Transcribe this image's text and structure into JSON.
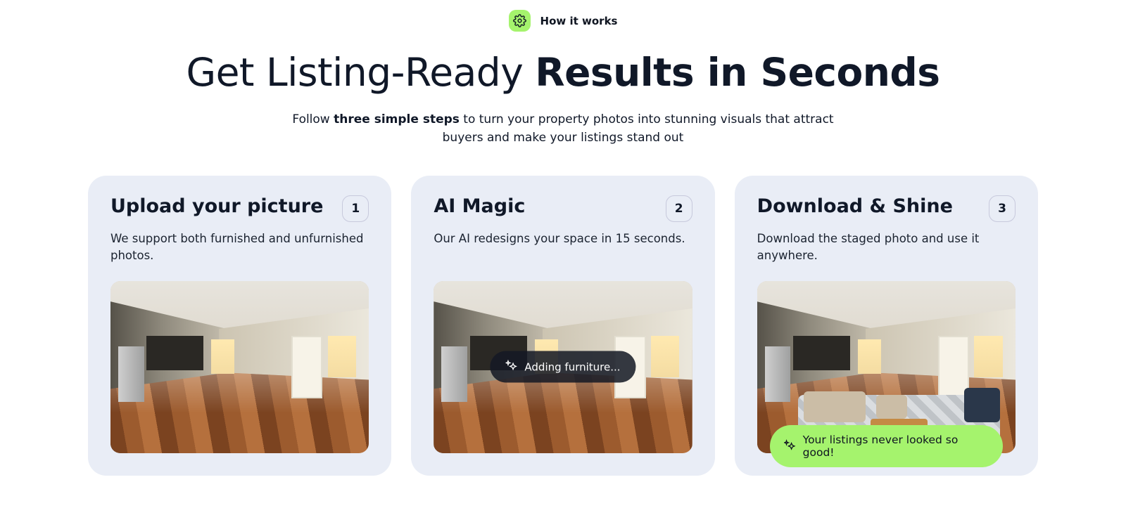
{
  "header": {
    "eyebrow": "How it works",
    "headline_prefix": "Get Listing-Ready ",
    "headline_bold": "Results in Seconds",
    "sub_prefix": "Follow ",
    "sub_bold": "three simple steps",
    "sub_suffix": " to turn your property photos into stunning visuals that attract buyers and make your listings stand out"
  },
  "cards": [
    {
      "number": "1",
      "title": "Upload your picture",
      "desc": "We support both furnished and unfurnished photos."
    },
    {
      "number": "2",
      "title": "AI Magic",
      "desc": "Our AI redesigns your space in 15 seconds.",
      "overlay": "Adding furniture..."
    },
    {
      "number": "3",
      "title": "Download & Shine",
      "desc": "Download the staged photo and use it anywhere.",
      "banner": "Your listings never looked so good!"
    }
  ]
}
